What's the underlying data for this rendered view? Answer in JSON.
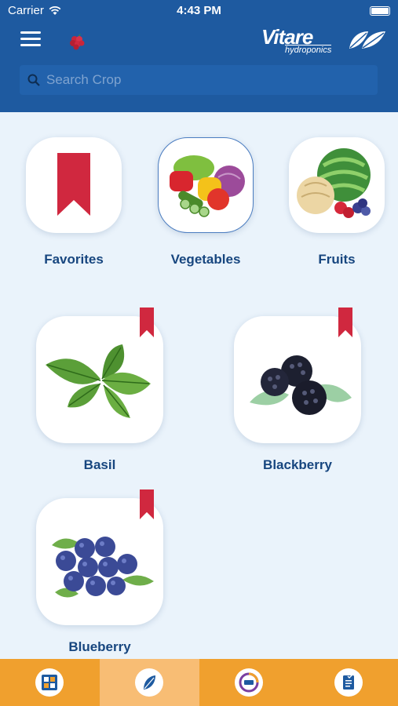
{
  "status_bar": {
    "carrier": "Carrier",
    "time": "4:43 PM"
  },
  "header": {
    "logo_word": "Vitare",
    "logo_sub": "hydroponics",
    "search_placeholder": "Search Crop"
  },
  "categories": [
    {
      "label": "Favorites"
    },
    {
      "label": "Vegetables",
      "selected": true
    },
    {
      "label": "Fruits"
    }
  ],
  "crops": [
    {
      "label": "Basil",
      "favorite": true
    },
    {
      "label": "Blackberry",
      "favorite": true
    },
    {
      "label": "Blueberry",
      "favorite": true
    }
  ],
  "tabs": [
    {
      "icon": "dashboard-icon"
    },
    {
      "icon": "leaf-icon",
      "active": true
    },
    {
      "icon": "pro-icon"
    },
    {
      "icon": "notes-icon"
    }
  ],
  "colors": {
    "header": "#1e5aa0",
    "tabbar": "#f0a02e",
    "accent_red": "#d0283f",
    "label": "#17467f"
  }
}
